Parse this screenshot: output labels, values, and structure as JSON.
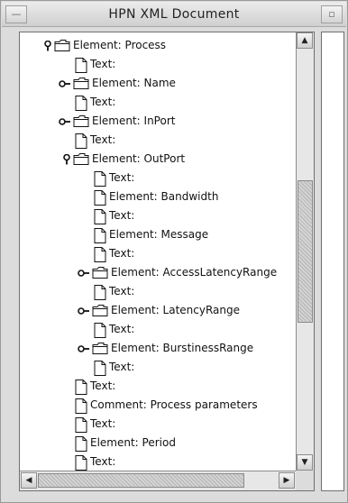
{
  "window": {
    "title": "HPN XML Document",
    "minimize_glyph": "—",
    "maximize_glyph": "▫"
  },
  "tree": {
    "nodes": [
      {
        "label": "Element: Process",
        "type": "folder",
        "depth": 0,
        "handle": "expanded"
      },
      {
        "label": "Text:",
        "type": "doc",
        "depth": 1,
        "handle": "none"
      },
      {
        "label": "Element: Name",
        "type": "folder",
        "depth": 1,
        "handle": "collapsed"
      },
      {
        "label": "Text:",
        "type": "doc",
        "depth": 1,
        "handle": "none"
      },
      {
        "label": "Element: InPort",
        "type": "folder",
        "depth": 1,
        "handle": "collapsed"
      },
      {
        "label": "Text:",
        "type": "doc",
        "depth": 1,
        "handle": "none"
      },
      {
        "label": "Element: OutPort",
        "type": "folder",
        "depth": 1,
        "handle": "expanded"
      },
      {
        "label": "Text:",
        "type": "doc",
        "depth": 2,
        "handle": "none"
      },
      {
        "label": "Element: Bandwidth",
        "type": "doc",
        "depth": 2,
        "handle": "none"
      },
      {
        "label": "Text:",
        "type": "doc",
        "depth": 2,
        "handle": "none"
      },
      {
        "label": "Element: Message",
        "type": "doc",
        "depth": 2,
        "handle": "none"
      },
      {
        "label": "Text:",
        "type": "doc",
        "depth": 2,
        "handle": "none"
      },
      {
        "label": "Element: AccessLatencyRange",
        "type": "folder",
        "depth": 2,
        "handle": "collapsed"
      },
      {
        "label": "Text:",
        "type": "doc",
        "depth": 2,
        "handle": "none"
      },
      {
        "label": "Element: LatencyRange",
        "type": "folder",
        "depth": 2,
        "handle": "collapsed"
      },
      {
        "label": "Text:",
        "type": "doc",
        "depth": 2,
        "handle": "none"
      },
      {
        "label": "Element: BurstinessRange",
        "type": "folder",
        "depth": 2,
        "handle": "collapsed"
      },
      {
        "label": "Text:",
        "type": "doc",
        "depth": 2,
        "handle": "none"
      },
      {
        "label": "Text:",
        "type": "doc",
        "depth": 1,
        "handle": "none"
      },
      {
        "label": "Comment: Process parameters",
        "type": "doc",
        "depth": 1,
        "handle": "none"
      },
      {
        "label": "Text:",
        "type": "doc",
        "depth": 1,
        "handle": "none"
      },
      {
        "label": "Element: Period",
        "type": "doc",
        "depth": 1,
        "handle": "none"
      },
      {
        "label": "Text:",
        "type": "doc",
        "depth": 1,
        "handle": "none"
      },
      {
        "label": "",
        "type": "doc",
        "depth": 1,
        "handle": "none"
      }
    ]
  },
  "scrollbars": {
    "vertical": {
      "up_glyph": "▲",
      "down_glyph": "▼",
      "position": 0.5,
      "visible_fraction": 0.35
    },
    "horizontal": {
      "left_glyph": "◀",
      "right_glyph": "▶",
      "position": 0.0,
      "visible_fraction": 0.86
    }
  }
}
